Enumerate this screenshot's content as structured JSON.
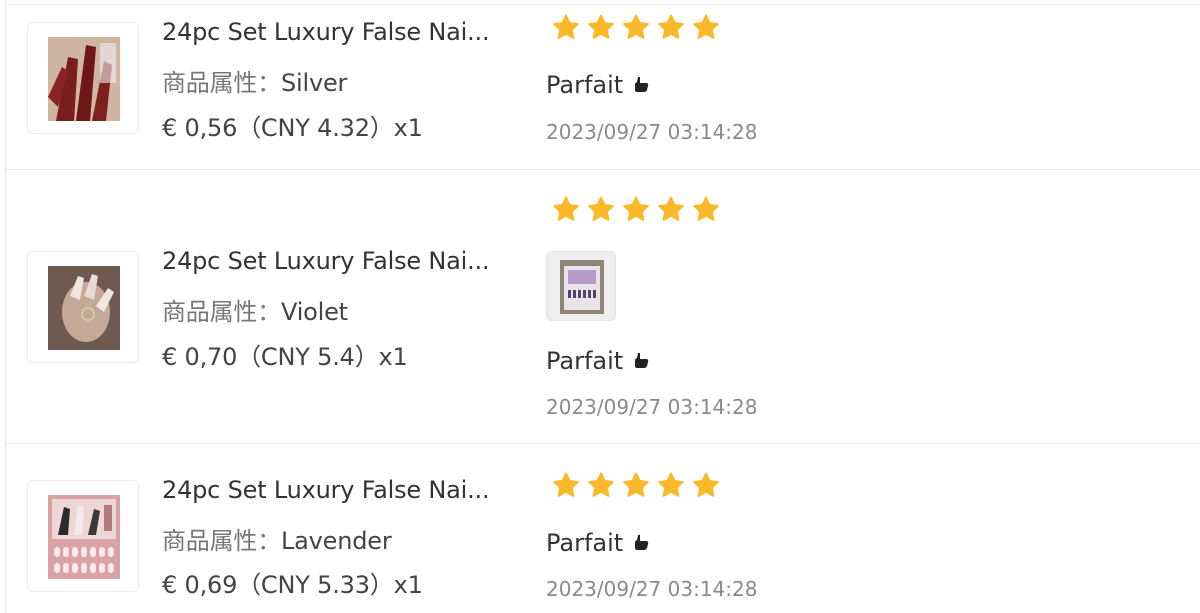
{
  "reviews": [
    {
      "product_title": "24pc Set Luxury False Nai...",
      "attr_label": "商品属性：",
      "attr_value": "Silver",
      "price": "€ 0,56（CNY  4.32）x1",
      "rating": 5,
      "has_photo": false,
      "comment": "Parfait",
      "comment_icon": "thumbs-up-icon",
      "date": "2023/09/27 03:14:28",
      "thumb_colors": [
        "#7a1d1d",
        "#c9a58a"
      ]
    },
    {
      "product_title": "24pc Set Luxury False Nai...",
      "attr_label": "商品属性：",
      "attr_value": "Violet",
      "price": "€ 0,70（CNY  5.4）x1",
      "rating": 5,
      "has_photo": true,
      "comment": "Parfait",
      "comment_icon": "thumbs-up-icon",
      "date": "2023/09/27 03:14:28",
      "thumb_colors": [
        "#8a6f62",
        "#e9e2dc"
      ]
    },
    {
      "product_title": "24pc Set Luxury False Nai...",
      "attr_label": "商品属性：",
      "attr_value": "Lavender",
      "price": "€ 0,69（CNY  5.33）x1",
      "rating": 5,
      "has_photo": false,
      "comment": "Parfait",
      "comment_icon": "thumbs-up-icon",
      "date": "2023/09/27 03:14:28",
      "thumb_colors": [
        "#d9a3a3",
        "#f4dede"
      ]
    }
  ],
  "colors": {
    "star": "#fbb829",
    "divider": "#ebebeb",
    "date": "#8a8a8a"
  }
}
